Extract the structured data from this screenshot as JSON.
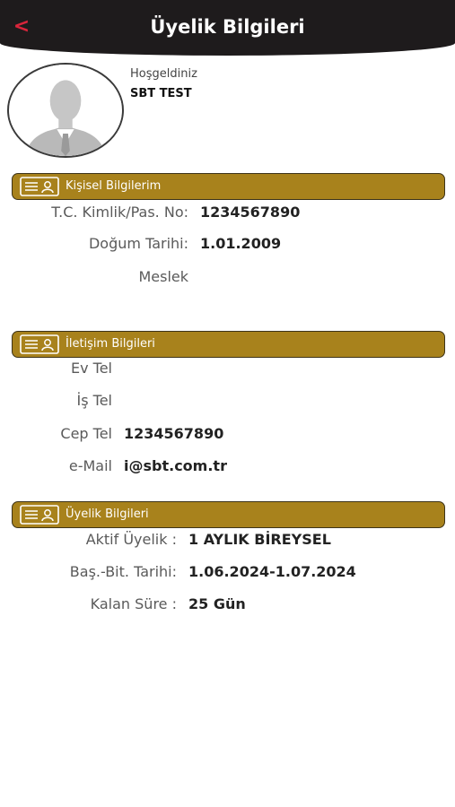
{
  "header": {
    "title": "Üyelik Bilgileri",
    "back_glyph": "<"
  },
  "profile": {
    "welcome": "Hoşgeldiniz",
    "name": "SBT TEST",
    "avatar_icon": "user-silhouette-icon"
  },
  "colors": {
    "header_bg": "#1e1b1c",
    "accent_gold": "#a8821c",
    "back_red": "#d9253b"
  },
  "personal": {
    "title": "Kişisel Bilgilerim",
    "id_label": "T.C. Kimlik/Pas. No:",
    "id_value": "1234567890",
    "birth_label": "Doğum Tarihi:",
    "birth_value": "1.01.2009",
    "job_label": "Meslek",
    "job_value": ""
  },
  "contact": {
    "title": "İletişim Bilgileri",
    "home_label": "Ev Tel",
    "home_value": "",
    "work_label": "İş Tel",
    "work_value": "",
    "mobile_label": "Cep Tel",
    "mobile_value": "1234567890",
    "email_label": "e-Mail",
    "email_value": "i@sbt.com.tr"
  },
  "membership": {
    "title": "Üyelik Bilgileri",
    "active_label": "Aktif Üyelik :",
    "active_value": "1 AYLIK BİREYSEL",
    "period_label": "Baş.-Bit. Tarihi:",
    "period_value": "1.06.2024-1.07.2024",
    "remaining_label": "Kalan Süre :",
    "remaining_value": "25 Gün"
  }
}
